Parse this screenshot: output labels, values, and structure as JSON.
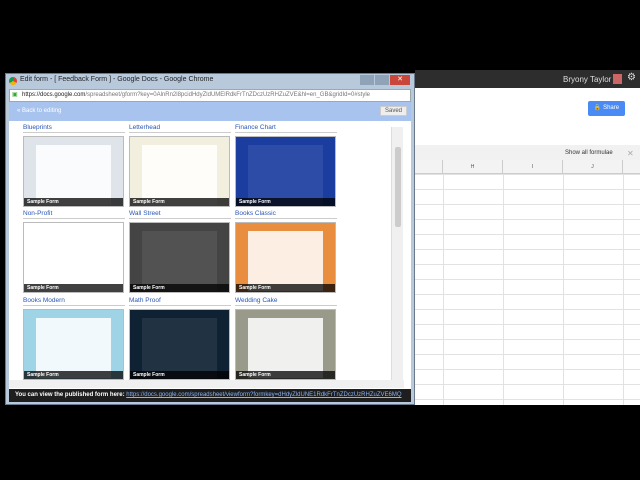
{
  "sheet": {
    "user": "Bryony Taylor",
    "share_label": "Share",
    "show_formulae": "Show all formulae",
    "columns": [
      "H",
      "I",
      "J"
    ]
  },
  "window": {
    "title": "Edit form - [ Feedback Form ] - Google Docs - Google Chrome",
    "url_host": "https://docs.google.com",
    "url_path": "/spreadsheet/gform?key=0AlnRn2l8pcidHdyZldUMElRdkFrTnZDczUzRHZuZVE&hl=en_GB&gridId=0#style",
    "back_label": "« Back to editing",
    "saved_label": "Saved",
    "themes": [
      {
        "name": "Blueprints",
        "bg": "#dfe4ea"
      },
      {
        "name": "Letterhead",
        "bg": "#f3efdf"
      },
      {
        "name": "Finance Chart",
        "bg": "#1b3da0"
      },
      {
        "name": "Non-Profit",
        "bg": "#ffffff"
      },
      {
        "name": "Wall Street",
        "bg": "#444444"
      },
      {
        "name": "Books Classic",
        "bg": "#e98d3f"
      },
      {
        "name": "Books Modern",
        "bg": "#9fd3e6"
      },
      {
        "name": "Math Proof",
        "bg": "#0f2233"
      },
      {
        "name": "Wedding Cake",
        "bg": "#9a9a8a"
      }
    ],
    "sample_label": "Sample Form",
    "bottom_text": "You can view the published form here:",
    "bottom_link": "https://docs.google.com/spreadsheet/viewform?formkey=dHdyZldUNE1RdkFrTnZDczUzRHZuZVE6MQ"
  }
}
